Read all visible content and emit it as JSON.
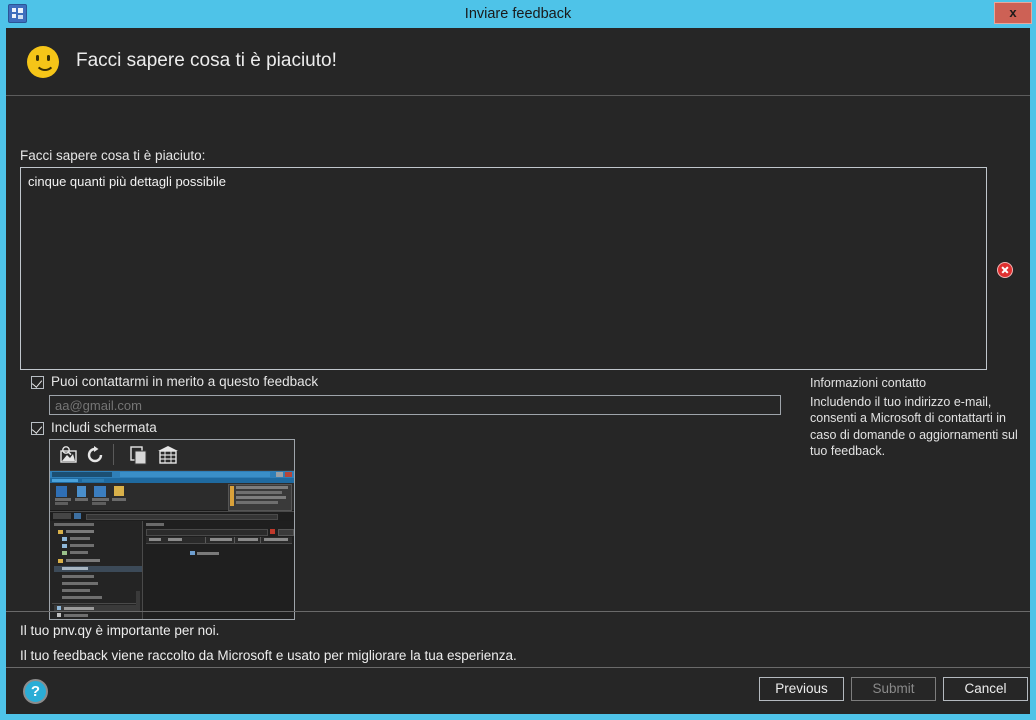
{
  "window": {
    "title": "Inviare feedback",
    "app_icon": "app-window-icon",
    "close_label": "x"
  },
  "header": {
    "icon": "smiley-face-icon",
    "title": "Facci sapere cosa ti è piaciuto!"
  },
  "main": {
    "feedback_label": "Facci sapere cosa ti è piaciuto:",
    "feedback_value": "cinque quanti più dettagli possibile",
    "feedback_placeholder": "",
    "error_icon": "error-icon",
    "contact_checkbox": {
      "label": "Puoi contattarmi in merito a questo feedback",
      "checked": true
    },
    "email": {
      "value": "aa@gmail.com",
      "placeholder": "aa@gmail.com"
    },
    "screenshot_checkbox": {
      "label": "Includi schermata",
      "checked": true
    },
    "thumbnail_name": "screenshot-thumbnail"
  },
  "contact_info": {
    "title": "Informazioni contatto",
    "body": "Includendo il tuo indirizzo e-mail, consenti a Microsoft di contattarti in caso di domande o aggiornamenti sul tuo feedback."
  },
  "privacy": {
    "line1": "Il tuo pnv.qy è importante per noi.",
    "line2": "Il tuo feedback viene raccolto da Microsoft e usato per migliorare la tua esperienza."
  },
  "footer": {
    "help_label": "?",
    "previous_label": "Previous",
    "submit_label": "Submit",
    "cancel_label": "Cancel"
  },
  "colors": {
    "window_frame": "#4ec3e8",
    "client_bg": "#262626",
    "close_button": "#cd6155",
    "accent_help": "#2badd6",
    "smiley": "#f5c518",
    "error": "#e03030"
  }
}
